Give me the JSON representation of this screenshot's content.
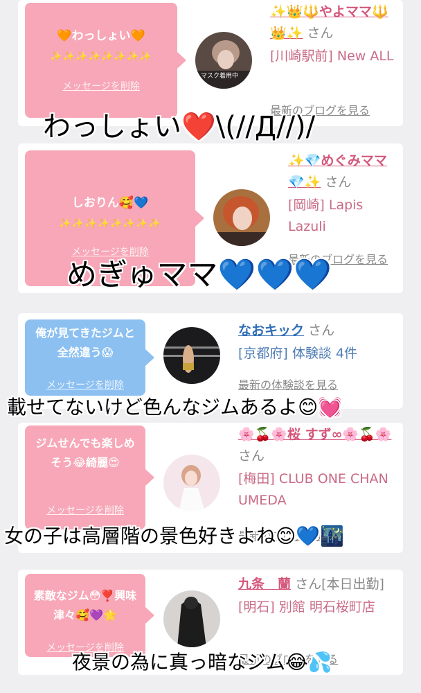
{
  "cards": [
    {
      "message": "🧡わっしょい🧡",
      "sparkles": "✨✨✨✨✨✨✨✨",
      "delete_label": "メッセージを削除",
      "name": "✨👑🔱やよママ🔱👑✨",
      "san": "さん",
      "location": "[川崎駅前] New ALL",
      "more": "最新のブログを見る",
      "avatar_caption": "マスク着用中",
      "overlay": "わっしょい❤️\\(//Д//)/"
    },
    {
      "message": "しおりん🥰💙",
      "sparkles": "✨✨✨✨✨✨✨✨",
      "delete_label": "メッセージを削除",
      "name": "✨💎めぐみママ💎✨",
      "san": "さん",
      "location": "[岡崎] Lapis Lazuli",
      "more": "最新のブログを見る",
      "overlay": "めぎゅママ💙💙💙"
    },
    {
      "message": "俺が見てきたジムと全然違う😱",
      "delete_label": "メッセージを削除",
      "name": "なおキック",
      "san": "さん",
      "location": "[京都府] 体験談 4件",
      "more": "最新の体験談を見る",
      "overlay": "載せてないけど色んなジムあるよ😊💓"
    },
    {
      "message": "ジムせんでも楽しめそう😂綺麗😍",
      "delete_label": "メッセージを削除",
      "name": "🌸🍒🌸桜 すず∞🌸🍒🌸",
      "san": "さん",
      "location": "[梅田] CLUB ONE CHAN UMEDA",
      "more": "最新のブログを見る",
      "overlay": "女の子は高層階の景色好きよね😊💙🌃"
    },
    {
      "message": "素敵なジム😳❣️興味津々🥰💜🌟",
      "delete_label": "メッセージを削除",
      "name": "九条　蘭",
      "san": "さん[本日出勤]",
      "location": "[明石] 別館 明石桜町店",
      "more": "最新のブログを見る",
      "overlay": "夜景の為に真っ暗なジム😂💦"
    }
  ],
  "colors": {
    "pink_bubble": "#f7a7b7",
    "blue_bubble": "#8cc0f1",
    "pink_name": "#d4567a",
    "blue_name": "#2f6db5"
  }
}
